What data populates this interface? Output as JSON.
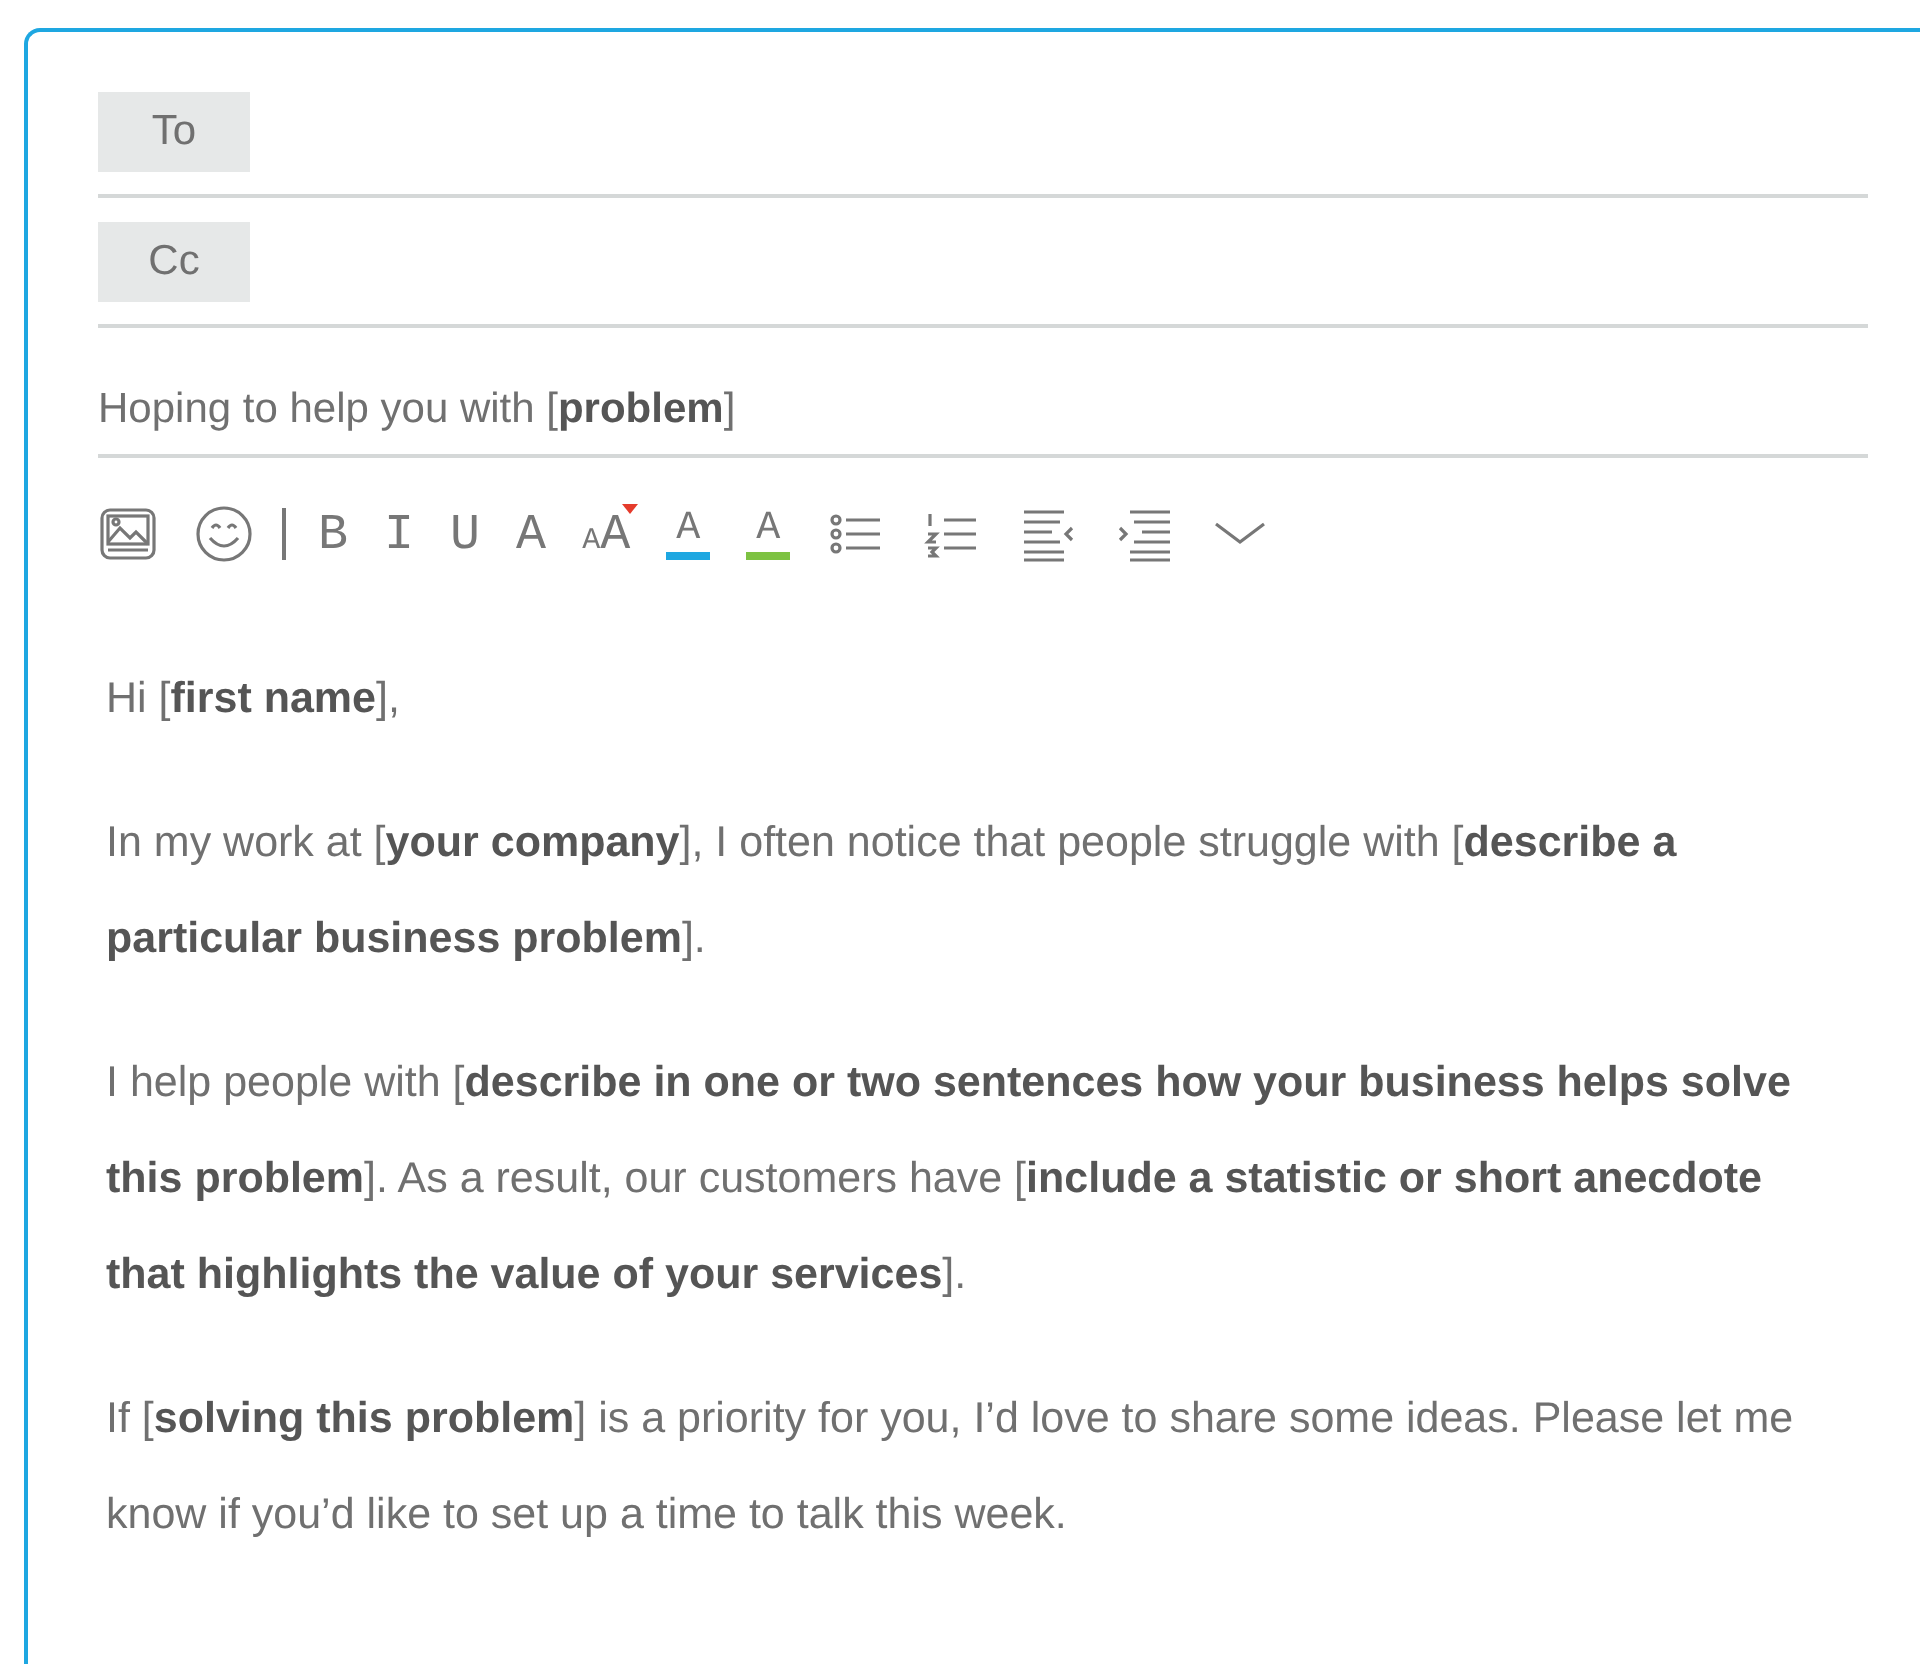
{
  "fields": [
    {
      "label": "To"
    },
    {
      "label": "Cc"
    }
  ],
  "subject": {
    "value": "Hoping to help you with [**problem**]"
  },
  "toolbar": [
    {
      "kind": "image"
    },
    {
      "kind": "emoji"
    },
    {
      "kind": "separator"
    },
    {
      "kind": "letter",
      "text": "B"
    },
    {
      "kind": "letter",
      "text": "I"
    },
    {
      "kind": "letter",
      "text": "U"
    },
    {
      "kind": "letter",
      "text": "A"
    },
    {
      "kind": "size",
      "small": "A",
      "large": "A"
    },
    {
      "kind": "highlight",
      "text": "A",
      "color": "#1ea7e1"
    },
    {
      "kind": "textcolor",
      "text": "A",
      "color": "#7dc242"
    },
    {
      "kind": "bullets"
    },
    {
      "kind": "numbers"
    },
    {
      "kind": "outdent"
    },
    {
      "kind": "indent"
    },
    {
      "kind": "more"
    }
  ],
  "body": [
    "Hi [**first name**],",
    "In my work at [**your company**], I often notice that people struggle with [**describe a particular business problem**].",
    "I help people with [**describe in one or two sentences how your business helps solve this problem**]. As a result, our customers have [**include a statistic or short anecdote that highlights the value of your services**].",
    "If [**solving this problem**] is a priority for you, I’d love to share some ideas. Please let me know if you’d like to set up a time to talk this week."
  ]
}
